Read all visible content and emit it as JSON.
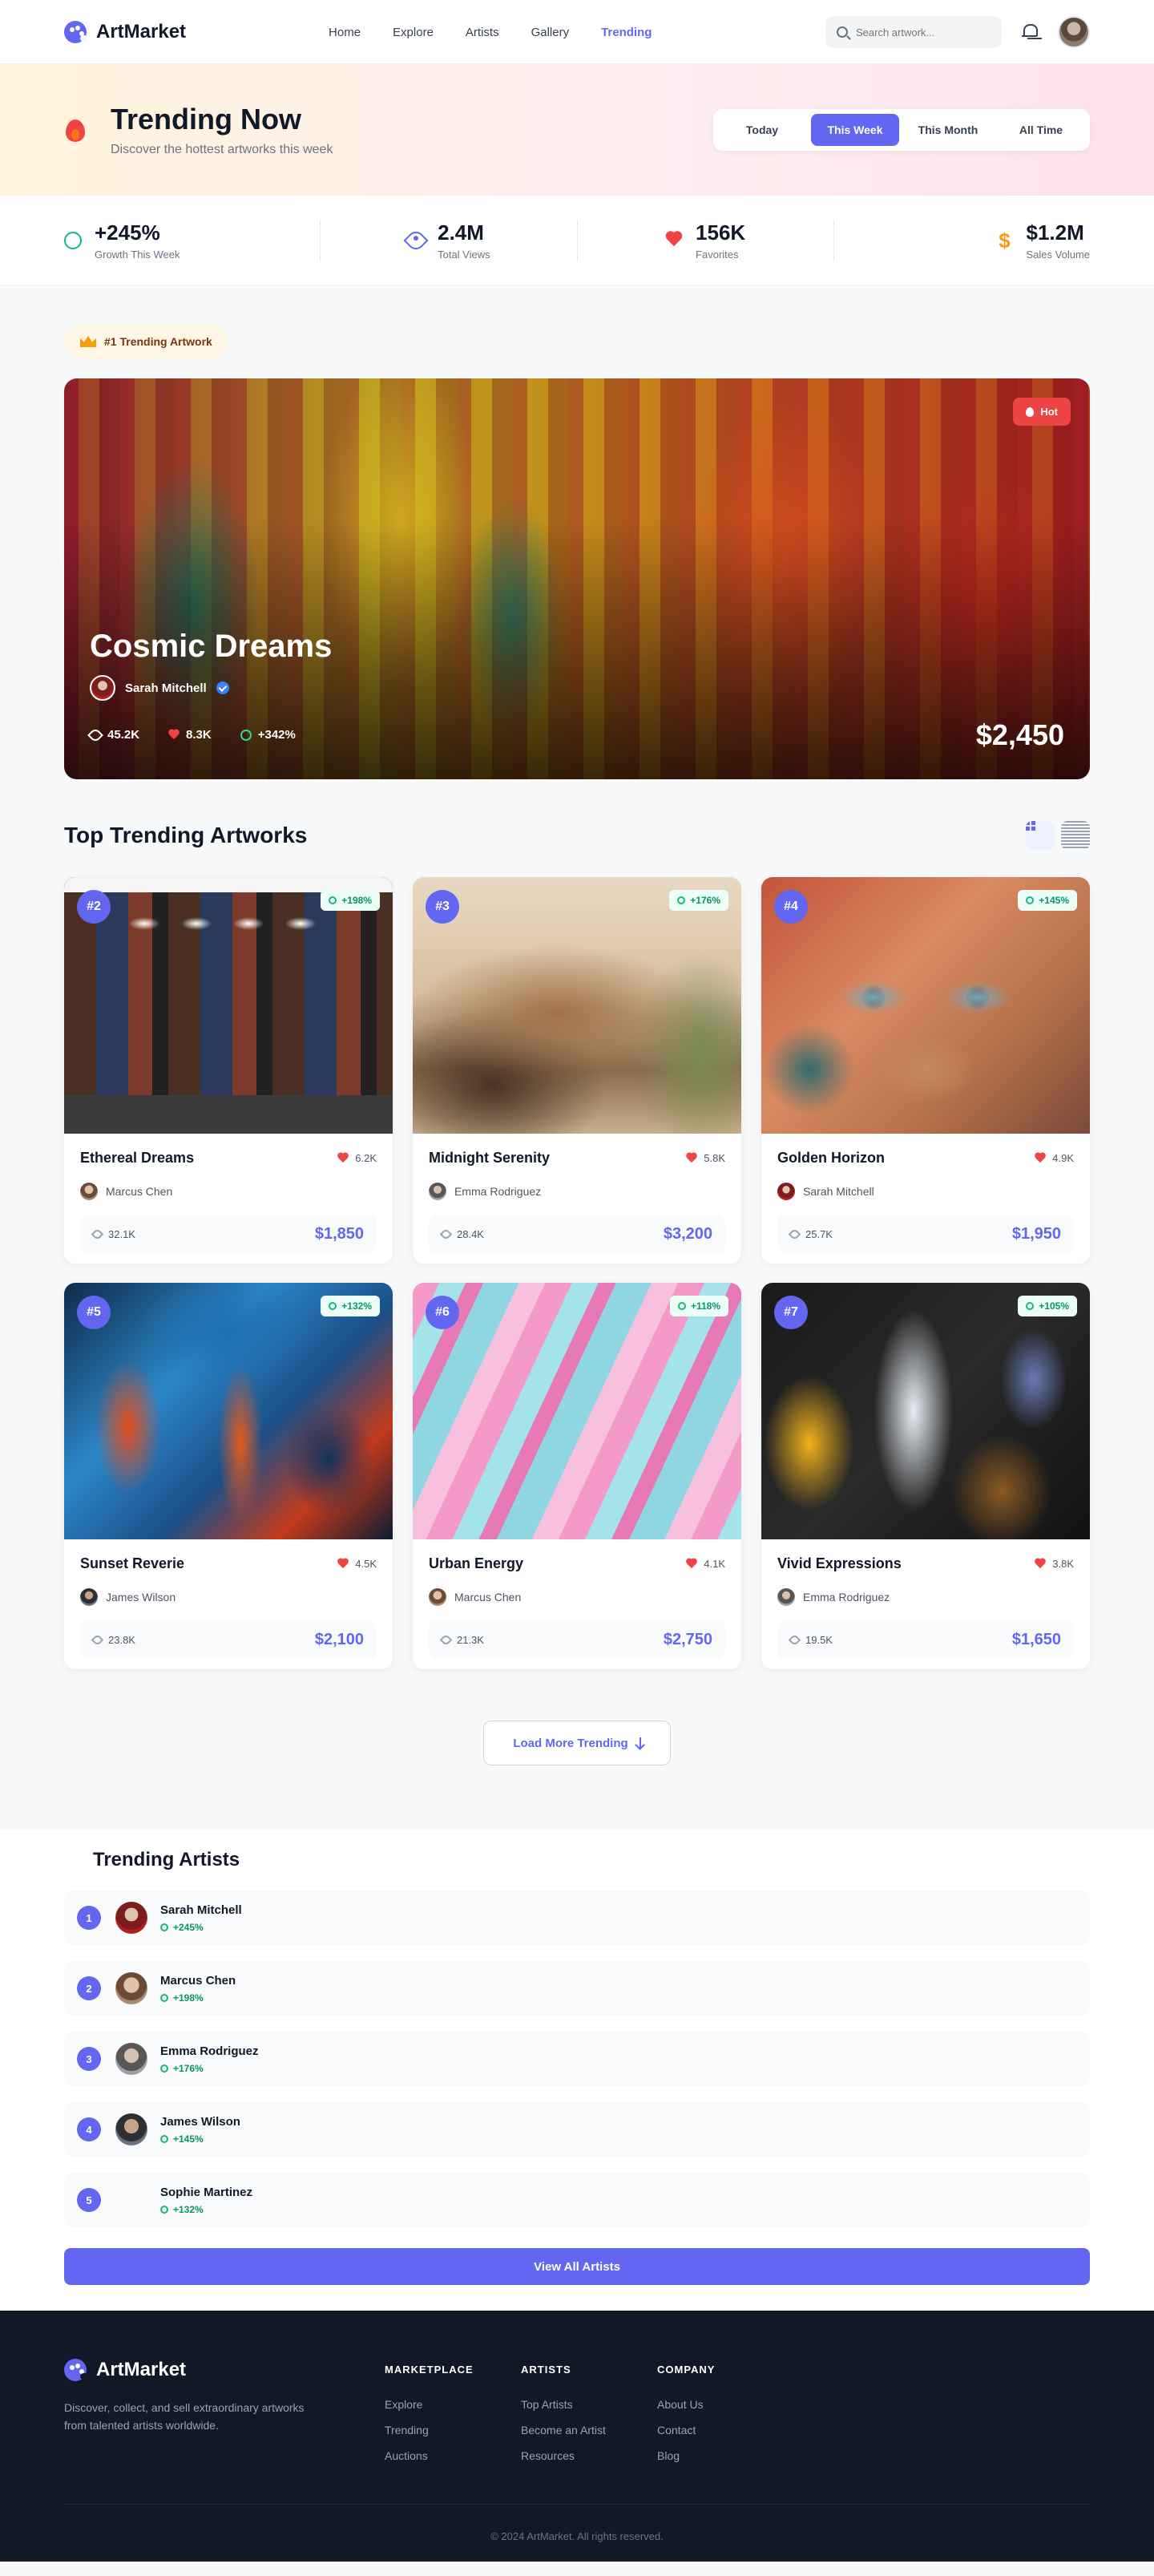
{
  "nav": {
    "brand": "ArtMarket",
    "links": [
      "Home",
      "Explore",
      "Artists",
      "Gallery",
      "Trending"
    ],
    "active_link": "Trending",
    "search_placeholder": "Search artwork..."
  },
  "hero": {
    "title": "Trending Now",
    "subtitle": "Discover the hottest artworks this week",
    "periods": [
      "Today",
      "This Week",
      "This Month",
      "All Time"
    ],
    "active_period": "This Week"
  },
  "stats": [
    {
      "value": "+245%",
      "label": "Growth This Week",
      "icon": "trending-ring-icon"
    },
    {
      "value": "2.4M",
      "label": "Total Views",
      "icon": "eye-icon"
    },
    {
      "value": "156K",
      "label": "Favorites",
      "icon": "heart-icon"
    },
    {
      "value": "$1.2M",
      "label": "Sales Volume",
      "icon": "dollar-icon"
    }
  ],
  "featured": {
    "badge": "#1 Trending Artwork",
    "hot_label": "Hot",
    "title": "Cosmic Dreams",
    "artist": "Sarah Mitchell",
    "views": "45.2K",
    "likes": "8.3K",
    "growth": "+342%",
    "price": "$2,450"
  },
  "grid": {
    "title": "Top Trending Artworks",
    "artworks": [
      {
        "rank": "#2",
        "growth": "+198%",
        "title": "Ethereal Dreams",
        "likes": "6.2K",
        "artist": "Marcus Chen",
        "views": "32.1K",
        "price": "$1,850"
      },
      {
        "rank": "#3",
        "growth": "+176%",
        "title": "Midnight Serenity",
        "likes": "5.8K",
        "artist": "Emma Rodriguez",
        "views": "28.4K",
        "price": "$3,200"
      },
      {
        "rank": "#4",
        "growth": "+145%",
        "title": "Golden Horizon",
        "likes": "4.9K",
        "artist": "Sarah Mitchell",
        "views": "25.7K",
        "price": "$1,950"
      },
      {
        "rank": "#5",
        "growth": "+132%",
        "title": "Sunset Reverie",
        "likes": "4.5K",
        "artist": "James Wilson",
        "views": "23.8K",
        "price": "$2,100"
      },
      {
        "rank": "#6",
        "growth": "+118%",
        "title": "Urban Energy",
        "likes": "4.1K",
        "artist": "Marcus Chen",
        "views": "21.3K",
        "price": "$2,750"
      },
      {
        "rank": "#7",
        "growth": "+105%",
        "title": "Vivid Expressions",
        "likes": "3.8K",
        "artist": "Emma Rodriguez",
        "views": "19.5K",
        "price": "$1,650"
      }
    ],
    "load_more": "Load More Trending"
  },
  "trending_artists": {
    "title": "Trending Artists",
    "items": [
      {
        "rank": "1",
        "name": "Sarah Mitchell",
        "growth": "+245%"
      },
      {
        "rank": "2",
        "name": "Marcus Chen",
        "growth": "+198%"
      },
      {
        "rank": "3",
        "name": "Emma Rodriguez",
        "growth": "+176%"
      },
      {
        "rank": "4",
        "name": "James Wilson",
        "growth": "+145%"
      },
      {
        "rank": "5",
        "name": "Sophie Martinez",
        "growth": "+132%"
      }
    ],
    "view_all": "View All Artists"
  },
  "footer": {
    "brand": "ArtMarket",
    "tagline": "Discover, collect, and sell extraordinary artworks from talented artists worldwide.",
    "columns": [
      {
        "heading": "MARKETPLACE",
        "links": [
          "Explore",
          "Trending",
          "Auctions"
        ]
      },
      {
        "heading": "ARTISTS",
        "links": [
          "Top Artists",
          "Become an Artist",
          "Resources"
        ]
      },
      {
        "heading": "COMPANY",
        "links": [
          "About Us",
          "Contact",
          "Blog"
        ]
      }
    ],
    "copyright": "© 2024 ArtMarket. All rights reserved."
  },
  "colors": {
    "accent": "#6366f1",
    "hot": "#ef4444",
    "growth": "#10b981",
    "footer_bg": "#111827"
  }
}
